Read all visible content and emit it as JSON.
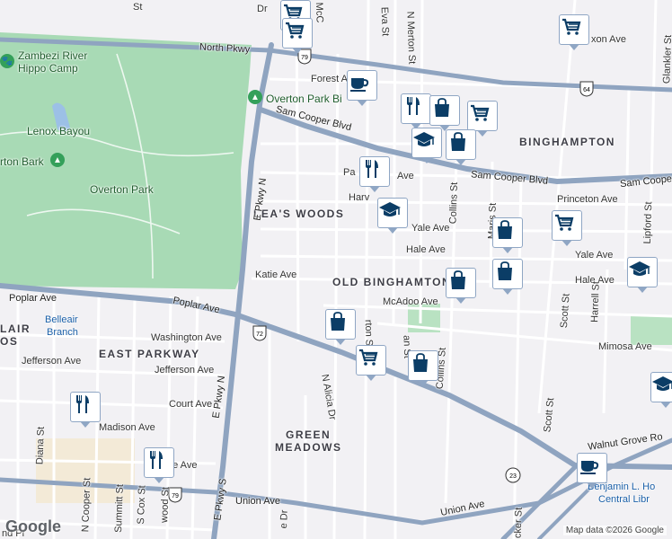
{
  "map": {
    "attribution": "Map data ©2026 Google",
    "logo": "Google",
    "colors": {
      "background": "#f2f1f4",
      "park": "#a8dab5",
      "highway": "#8fa4c0",
      "street": "#ffffff",
      "marker_icon": "#0b3d66",
      "marker_border": "#8fa6c4"
    },
    "neighborhoods": {
      "leas_woods": "LEA'S WOODS",
      "binghampton": "BINGHAMPTON",
      "old_binghampton": "OLD BINGHAMTON",
      "east_parkway": "EAST PARKWAY",
      "green_meadows_1": "GREEN",
      "green_meadows_2": "MEADOWS",
      "belleair_1": "LAIR",
      "belleair_2": "OS"
    },
    "parks": {
      "zambezi_1": "Zambezi River",
      "zambezi_2": "Hippo Camp",
      "lenox_bayou": "Lenox Bayou",
      "overton_bark": "rton Bark",
      "overton_park": "Overton Park",
      "overton_park_pin": "Overton Park Bi"
    },
    "places": {
      "belleair_branch_1": "Belleair",
      "belleair_branch_2": "Branch",
      "library_1": "Benjamin L. Ho",
      "library_2": "Central Libr"
    },
    "roads": {
      "north_pkwy": "North Pkwy",
      "forest_ave": "Forest Ave",
      "sam_cooper_1": "Sam Cooper Blvd",
      "sam_cooper_2": "Sam Cooper Blvd",
      "sam_cooper_3": "Sam Cooper",
      "poplar_1": "Poplar Ave",
      "poplar_2": "Poplar Ave",
      "washington": "Washington Ave",
      "jefferson_1": "Jefferson Ave",
      "jefferson_2": "Jefferson Ave",
      "court_ave": "Court Ave",
      "madison": "Madison Ave",
      "union_1": "Union Ave",
      "union_2": "Union Ave",
      "walnut_grove": "Walnut Grove Ro",
      "e_pkwy_n_1": "E Pkwy N",
      "e_pkwy_n_2": "E Pkwy N",
      "e_pkwy_s": "E Pkwy S",
      "katie": "Katie Ave",
      "hale_1": "Hale Ave",
      "hale_2": "Hale Ave",
      "yale_1": "Yale Ave",
      "yale_2": "Yale Ave",
      "mcadoo": "McAdoo Ave",
      "mimosa": "Mimosa Ave",
      "princeton": "Princeton Ave",
      "harvard": "Harv",
      "park_ave": "Pa",
      "park_ave_2": "Ave",
      "n_alicia": "N Alicia Dr",
      "collins_1": "Collins St",
      "collins_2": "Collins St",
      "scott_1": "Scott St",
      "scott_2": "Scott St",
      "eva": "Eva St",
      "n_merton": "N Merton St",
      "maris": "Maris St",
      "lipford": "Lipford St",
      "harrell": "Harrell St",
      "glankler": "Glankler St",
      "st_fragment": "St",
      "dr_fragment": "Dr",
      "mccrory": "McC",
      "merton_fragment": "rton St",
      "an_fragment": "an St",
      "diana": "Diana St",
      "n_cooper": "N Cooper St",
      "summitt": "Summitt St",
      "s_cox": "S Cox St",
      "wood": "wood St",
      "monroe": "oe Ave",
      "nd_pl": "nd Pl",
      "ne_dr": "e Dr",
      "xon_ave": "xon Ave",
      "cker": "cker St"
    },
    "shields": {
      "us79_north": "79",
      "us64": "64",
      "us72": "72",
      "us79_south": "79",
      "rt23": "23"
    },
    "markers": [
      {
        "type": "grocery",
        "name": "grocery-marker"
      },
      {
        "type": "grocery",
        "name": "grocery-marker"
      },
      {
        "type": "cafe",
        "name": "cafe-marker"
      },
      {
        "type": "restaurant",
        "name": "restaurant-marker"
      },
      {
        "type": "shopping",
        "name": "shopping-marker"
      },
      {
        "type": "grocery",
        "name": "grocery-marker"
      },
      {
        "type": "grocery",
        "name": "grocery-marker"
      },
      {
        "type": "school",
        "name": "school-marker"
      },
      {
        "type": "shopping",
        "name": "shopping-marker"
      },
      {
        "type": "restaurant",
        "name": "restaurant-marker"
      },
      {
        "type": "school",
        "name": "school-marker"
      },
      {
        "type": "shopping",
        "name": "shopping-marker"
      },
      {
        "type": "grocery",
        "name": "grocery-marker"
      },
      {
        "type": "shopping",
        "name": "shopping-marker"
      },
      {
        "type": "shopping",
        "name": "shopping-marker"
      },
      {
        "type": "school",
        "name": "school-marker"
      },
      {
        "type": "shopping",
        "name": "shopping-marker"
      },
      {
        "type": "grocery",
        "name": "grocery-marker"
      },
      {
        "type": "shopping",
        "name": "shopping-marker"
      },
      {
        "type": "restaurant",
        "name": "restaurant-marker"
      },
      {
        "type": "restaurant",
        "name": "restaurant-marker"
      },
      {
        "type": "school",
        "name": "school-marker"
      },
      {
        "type": "cafe",
        "name": "cafe-marker"
      }
    ]
  }
}
